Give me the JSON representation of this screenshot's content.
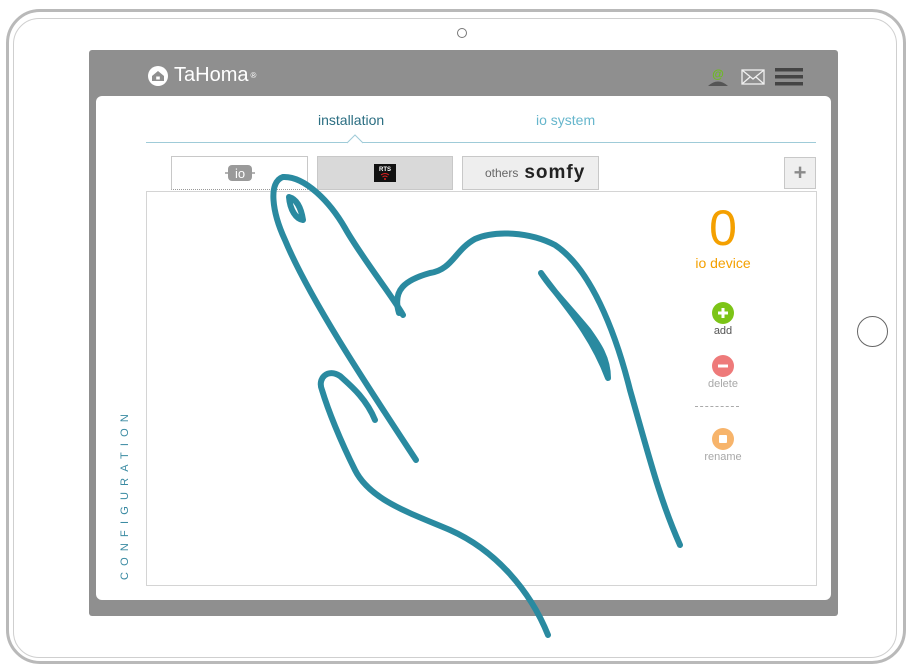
{
  "app": {
    "name": "TaHoma",
    "reg_mark": "®"
  },
  "header": {
    "icons": [
      "user-at-icon",
      "mail-icon",
      "menu-icon"
    ]
  },
  "tabs": [
    {
      "label": "installation",
      "active": true
    },
    {
      "label": "io system",
      "active": false
    }
  ],
  "subtabs": {
    "io_logo": "io",
    "rts_logo": "RTS",
    "others_label": "others",
    "somfy_logo": "somfy",
    "add_symbol": "+"
  },
  "device_count": {
    "value": "0",
    "label": "io device"
  },
  "actions": {
    "add_label": "add",
    "delete_label": "delete",
    "rename_label": "rename"
  },
  "sidebar": {
    "label": "CONFIGURATION"
  },
  "colors": {
    "accent": "#2b6e82",
    "count": "#f4a000",
    "add": "#7cc417",
    "delete": "#ee7a7a",
    "rename": "#f7b46b",
    "hand": "#2a8aa0"
  }
}
